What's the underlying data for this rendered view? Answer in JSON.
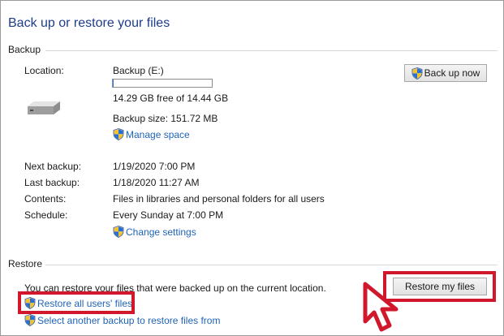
{
  "title": "Back up or restore your files",
  "backup": {
    "heading": "Backup",
    "location_label": "Location:",
    "location_value": "Backup (E:)",
    "disk_used_fraction": 0.01,
    "free_space": "14.29 GB free of 14.44 GB",
    "backup_size": "Backup size: 151.72 MB",
    "manage_space": "Manage space",
    "back_up_now": "Back up now",
    "next_backup_label": "Next backup:",
    "next_backup_value": "1/19/2020 7:00 PM",
    "last_backup_label": "Last backup:",
    "last_backup_value": "1/18/2020 11:27 AM",
    "contents_label": "Contents:",
    "contents_value": "Files in libraries and personal folders for all users",
    "schedule_label": "Schedule:",
    "schedule_value": "Every Sunday at 7:00 PM",
    "change_settings": "Change settings"
  },
  "restore": {
    "heading": "Restore",
    "description": "You can restore your files that were backed up on the current location.",
    "restore_my_files": "Restore my files",
    "restore_all_users": "Restore all users' files",
    "select_another": "Select another backup to restore files from"
  },
  "colors": {
    "title": "#1e3c8c",
    "link": "#1f63b8",
    "highlight": "#d0172b",
    "progress": "#2a78d6"
  },
  "icons": [
    "drive-icon",
    "shield-icon",
    "cursor-arrow-icon"
  ]
}
